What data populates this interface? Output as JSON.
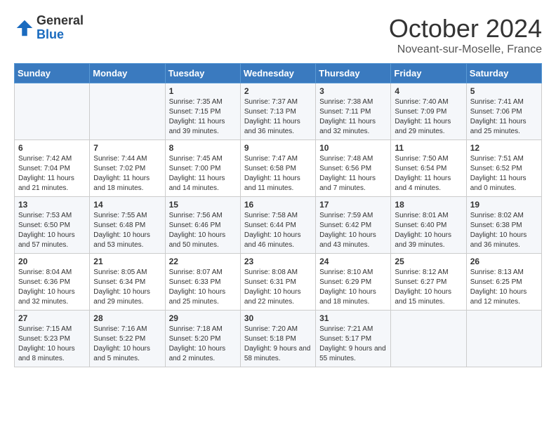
{
  "header": {
    "logo_general": "General",
    "logo_blue": "Blue",
    "month_title": "October 2024",
    "location": "Noveant-sur-Moselle, France"
  },
  "weekdays": [
    "Sunday",
    "Monday",
    "Tuesday",
    "Wednesday",
    "Thursday",
    "Friday",
    "Saturday"
  ],
  "weeks": [
    [
      {
        "day": "",
        "sunrise": "",
        "sunset": "",
        "daylight": ""
      },
      {
        "day": "",
        "sunrise": "",
        "sunset": "",
        "daylight": ""
      },
      {
        "day": "1",
        "sunrise": "Sunrise: 7:35 AM",
        "sunset": "Sunset: 7:15 PM",
        "daylight": "Daylight: 11 hours and 39 minutes."
      },
      {
        "day": "2",
        "sunrise": "Sunrise: 7:37 AM",
        "sunset": "Sunset: 7:13 PM",
        "daylight": "Daylight: 11 hours and 36 minutes."
      },
      {
        "day": "3",
        "sunrise": "Sunrise: 7:38 AM",
        "sunset": "Sunset: 7:11 PM",
        "daylight": "Daylight: 11 hours and 32 minutes."
      },
      {
        "day": "4",
        "sunrise": "Sunrise: 7:40 AM",
        "sunset": "Sunset: 7:09 PM",
        "daylight": "Daylight: 11 hours and 29 minutes."
      },
      {
        "day": "5",
        "sunrise": "Sunrise: 7:41 AM",
        "sunset": "Sunset: 7:06 PM",
        "daylight": "Daylight: 11 hours and 25 minutes."
      }
    ],
    [
      {
        "day": "6",
        "sunrise": "Sunrise: 7:42 AM",
        "sunset": "Sunset: 7:04 PM",
        "daylight": "Daylight: 11 hours and 21 minutes."
      },
      {
        "day": "7",
        "sunrise": "Sunrise: 7:44 AM",
        "sunset": "Sunset: 7:02 PM",
        "daylight": "Daylight: 11 hours and 18 minutes."
      },
      {
        "day": "8",
        "sunrise": "Sunrise: 7:45 AM",
        "sunset": "Sunset: 7:00 PM",
        "daylight": "Daylight: 11 hours and 14 minutes."
      },
      {
        "day": "9",
        "sunrise": "Sunrise: 7:47 AM",
        "sunset": "Sunset: 6:58 PM",
        "daylight": "Daylight: 11 hours and 11 minutes."
      },
      {
        "day": "10",
        "sunrise": "Sunrise: 7:48 AM",
        "sunset": "Sunset: 6:56 PM",
        "daylight": "Daylight: 11 hours and 7 minutes."
      },
      {
        "day": "11",
        "sunrise": "Sunrise: 7:50 AM",
        "sunset": "Sunset: 6:54 PM",
        "daylight": "Daylight: 11 hours and 4 minutes."
      },
      {
        "day": "12",
        "sunrise": "Sunrise: 7:51 AM",
        "sunset": "Sunset: 6:52 PM",
        "daylight": "Daylight: 11 hours and 0 minutes."
      }
    ],
    [
      {
        "day": "13",
        "sunrise": "Sunrise: 7:53 AM",
        "sunset": "Sunset: 6:50 PM",
        "daylight": "Daylight: 10 hours and 57 minutes."
      },
      {
        "day": "14",
        "sunrise": "Sunrise: 7:55 AM",
        "sunset": "Sunset: 6:48 PM",
        "daylight": "Daylight: 10 hours and 53 minutes."
      },
      {
        "day": "15",
        "sunrise": "Sunrise: 7:56 AM",
        "sunset": "Sunset: 6:46 PM",
        "daylight": "Daylight: 10 hours and 50 minutes."
      },
      {
        "day": "16",
        "sunrise": "Sunrise: 7:58 AM",
        "sunset": "Sunset: 6:44 PM",
        "daylight": "Daylight: 10 hours and 46 minutes."
      },
      {
        "day": "17",
        "sunrise": "Sunrise: 7:59 AM",
        "sunset": "Sunset: 6:42 PM",
        "daylight": "Daylight: 10 hours and 43 minutes."
      },
      {
        "day": "18",
        "sunrise": "Sunrise: 8:01 AM",
        "sunset": "Sunset: 6:40 PM",
        "daylight": "Daylight: 10 hours and 39 minutes."
      },
      {
        "day": "19",
        "sunrise": "Sunrise: 8:02 AM",
        "sunset": "Sunset: 6:38 PM",
        "daylight": "Daylight: 10 hours and 36 minutes."
      }
    ],
    [
      {
        "day": "20",
        "sunrise": "Sunrise: 8:04 AM",
        "sunset": "Sunset: 6:36 PM",
        "daylight": "Daylight: 10 hours and 32 minutes."
      },
      {
        "day": "21",
        "sunrise": "Sunrise: 8:05 AM",
        "sunset": "Sunset: 6:34 PM",
        "daylight": "Daylight: 10 hours and 29 minutes."
      },
      {
        "day": "22",
        "sunrise": "Sunrise: 8:07 AM",
        "sunset": "Sunset: 6:33 PM",
        "daylight": "Daylight: 10 hours and 25 minutes."
      },
      {
        "day": "23",
        "sunrise": "Sunrise: 8:08 AM",
        "sunset": "Sunset: 6:31 PM",
        "daylight": "Daylight: 10 hours and 22 minutes."
      },
      {
        "day": "24",
        "sunrise": "Sunrise: 8:10 AM",
        "sunset": "Sunset: 6:29 PM",
        "daylight": "Daylight: 10 hours and 18 minutes."
      },
      {
        "day": "25",
        "sunrise": "Sunrise: 8:12 AM",
        "sunset": "Sunset: 6:27 PM",
        "daylight": "Daylight: 10 hours and 15 minutes."
      },
      {
        "day": "26",
        "sunrise": "Sunrise: 8:13 AM",
        "sunset": "Sunset: 6:25 PM",
        "daylight": "Daylight: 10 hours and 12 minutes."
      }
    ],
    [
      {
        "day": "27",
        "sunrise": "Sunrise: 7:15 AM",
        "sunset": "Sunset: 5:23 PM",
        "daylight": "Daylight: 10 hours and 8 minutes."
      },
      {
        "day": "28",
        "sunrise": "Sunrise: 7:16 AM",
        "sunset": "Sunset: 5:22 PM",
        "daylight": "Daylight: 10 hours and 5 minutes."
      },
      {
        "day": "29",
        "sunrise": "Sunrise: 7:18 AM",
        "sunset": "Sunset: 5:20 PM",
        "daylight": "Daylight: 10 hours and 2 minutes."
      },
      {
        "day": "30",
        "sunrise": "Sunrise: 7:20 AM",
        "sunset": "Sunset: 5:18 PM",
        "daylight": "Daylight: 9 hours and 58 minutes."
      },
      {
        "day": "31",
        "sunrise": "Sunrise: 7:21 AM",
        "sunset": "Sunset: 5:17 PM",
        "daylight": "Daylight: 9 hours and 55 minutes."
      },
      {
        "day": "",
        "sunrise": "",
        "sunset": "",
        "daylight": ""
      },
      {
        "day": "",
        "sunrise": "",
        "sunset": "",
        "daylight": ""
      }
    ]
  ]
}
